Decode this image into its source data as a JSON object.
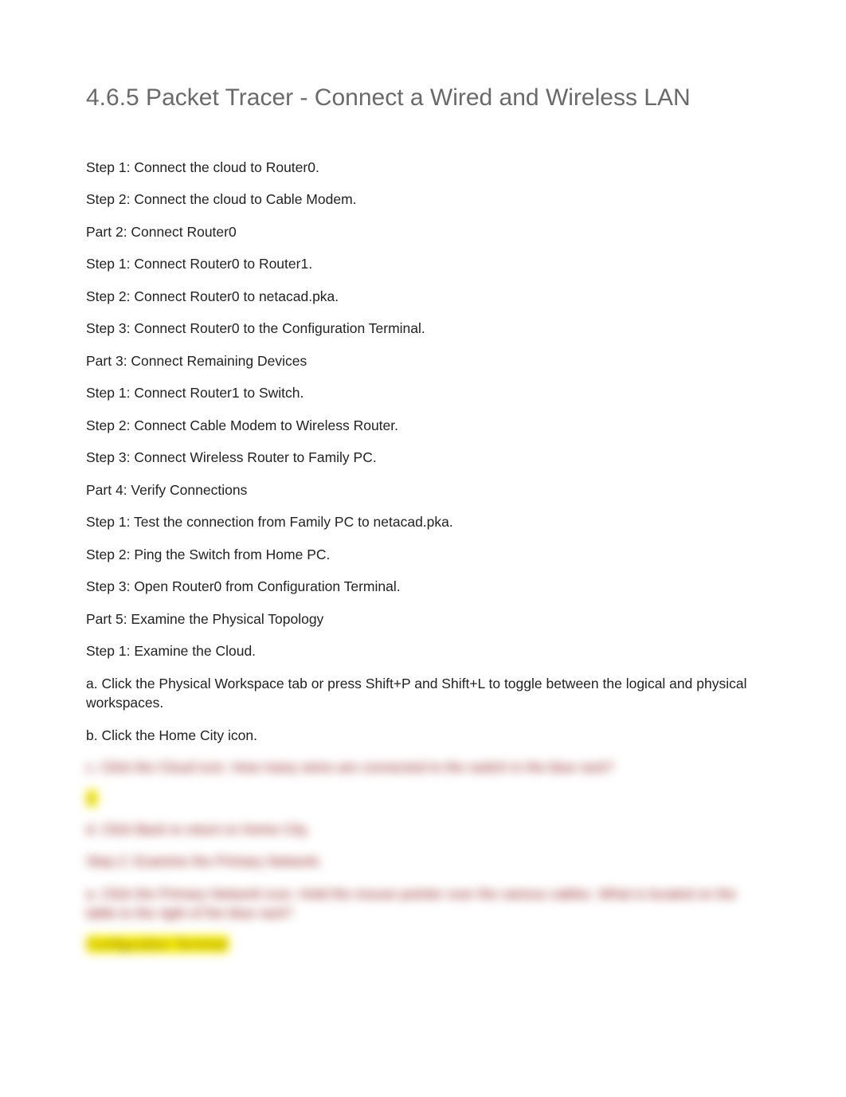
{
  "title": "4.6.5 Packet Tracer - Connect a Wired and Wireless LAN",
  "lines": [
    "Step 1: Connect the cloud to Router0.",
    "Step 2: Connect the cloud to Cable Modem.",
    "Part 2: Connect Router0",
    "Step 1: Connect Router0 to Router1.",
    "Step 2: Connect Router0 to netacad.pka.",
    "Step 3: Connect Router0 to the Configuration Terminal.",
    "Part 3: Connect Remaining Devices",
    "Step 1: Connect Router1 to Switch.",
    "Step 2: Connect Cable Modem to Wireless Router.",
    "Step 3: Connect Wireless Router to Family PC.",
    "Part 4: Verify Connections",
    "Step 1: Test the connection from Family PC to netacad.pka.",
    "Step 2: Ping the Switch from Home PC.",
    "Step 3: Open Router0 from Configuration Terminal.",
    "Part 5: Examine the Physical Topology",
    "Step 1: Examine the Cloud.",
    "a. Click the  Physical Workspace   tab or press   Shift+P  and  Shift+L  to toggle between the logical and physical workspaces.",
    "b. Click the  Home City  icon."
  ],
  "blurred": {
    "q1": "c. Click the Cloud icon. How many wires are connected to the switch in the blue rack?",
    "a1": "2",
    "q2": "d. Click Back to return to Home City.",
    "q3": "Step 2: Examine the Primary Network.",
    "q4": "a. Click the Primary Network icon. Hold the mouse pointer over the various cables. What is located on the table to the right of the blue rack?",
    "a2": "Configuration Terminal"
  }
}
